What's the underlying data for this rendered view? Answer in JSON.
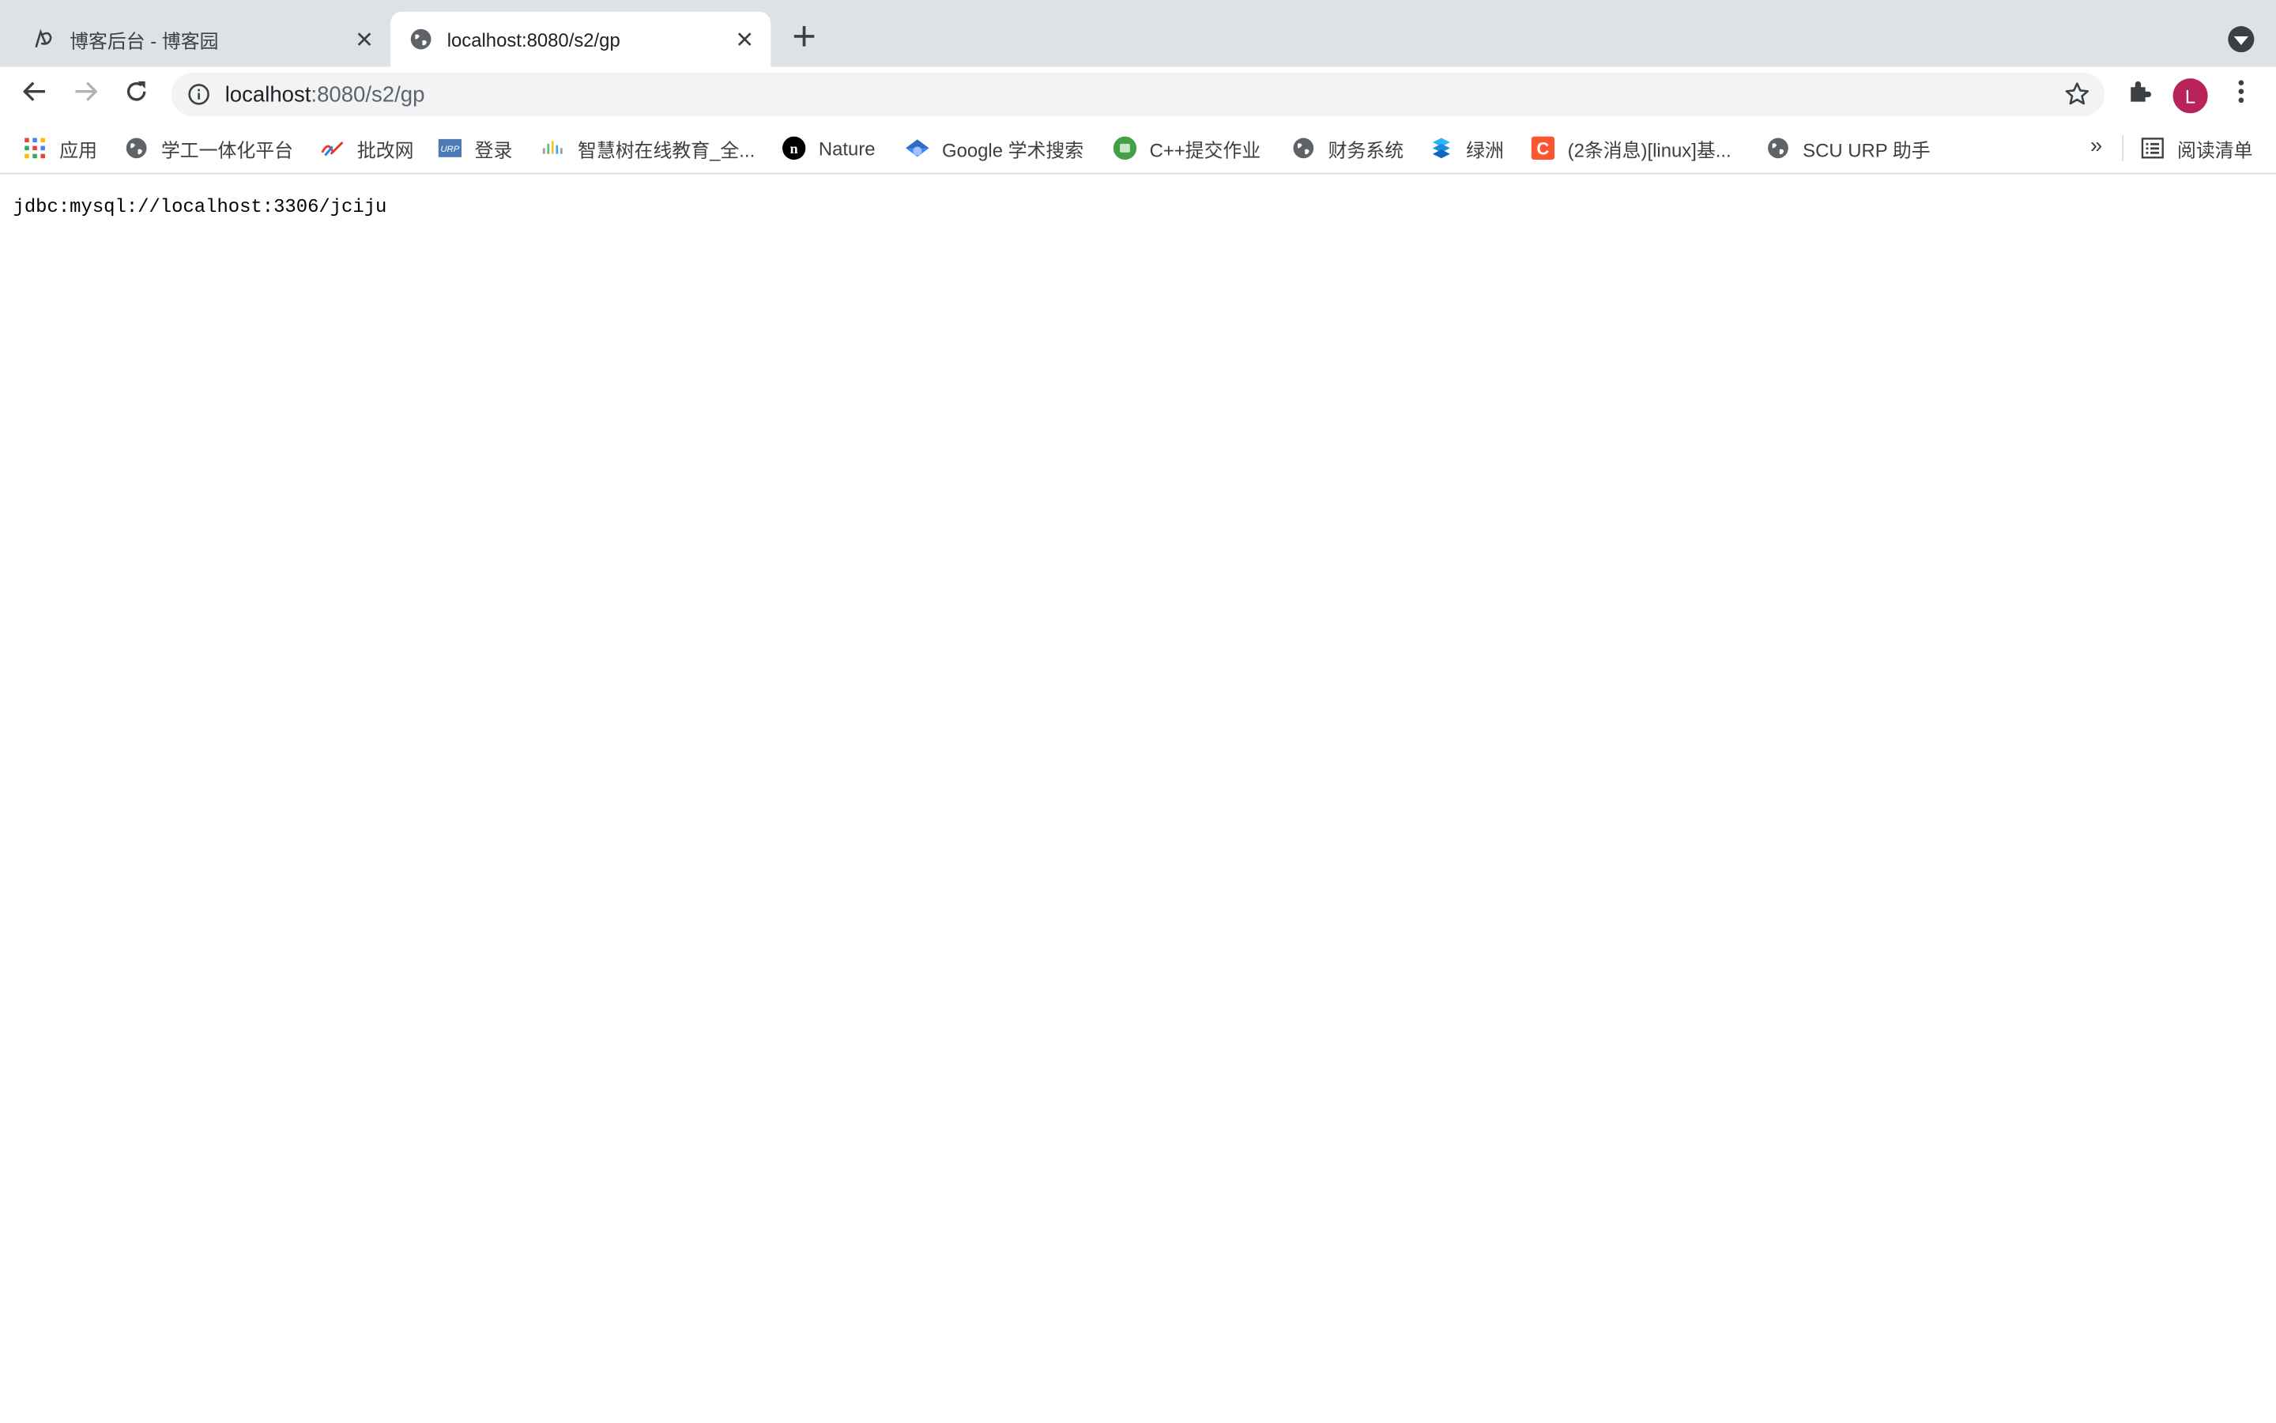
{
  "tabs": [
    {
      "title": "博客后台 - 博客园",
      "active": false,
      "favicon": "cnblogs-icon"
    },
    {
      "title": "localhost:8080/s2/gp",
      "active": true,
      "favicon": "globe-icon"
    }
  ],
  "toolbar": {
    "url_host": "localhost",
    "url_path": ":8080/s2/gp",
    "profile_initial": "L"
  },
  "bookmarks": [
    {
      "label": "应用",
      "icon": "apps-grid-icon"
    },
    {
      "label": "学工一体化平台",
      "icon": "globe-icon"
    },
    {
      "label": "批改网",
      "icon": "pigai-icon"
    },
    {
      "label": "登录",
      "icon": "urp-icon"
    },
    {
      "label": "智慧树在线教育_全...",
      "icon": "zhihuishu-icon"
    },
    {
      "label": "Nature",
      "icon": "nature-icon"
    },
    {
      "label": "Google 学术搜索",
      "icon": "google-scholar-icon"
    },
    {
      "label": "C++提交作业",
      "icon": "classroom-icon"
    },
    {
      "label": "财务系统",
      "icon": "globe-icon"
    },
    {
      "label": "绿洲",
      "icon": "oasis-icon"
    },
    {
      "label": "(2条消息)[linux]基...",
      "icon": "csdn-icon"
    },
    {
      "label": "SCU URP 助手",
      "icon": "globe-icon"
    }
  ],
  "bookmarks_more": "»",
  "reading_list": {
    "label": "阅读清单",
    "icon": "reading-list-icon"
  },
  "page": {
    "body_text": "jdbc:mysql://localhost:3306/jciju"
  },
  "colors": {
    "tabstrip_bg": "#dee1e6",
    "omnibox_bg": "#f1f3f4",
    "avatar_bg": "#b8235a"
  }
}
